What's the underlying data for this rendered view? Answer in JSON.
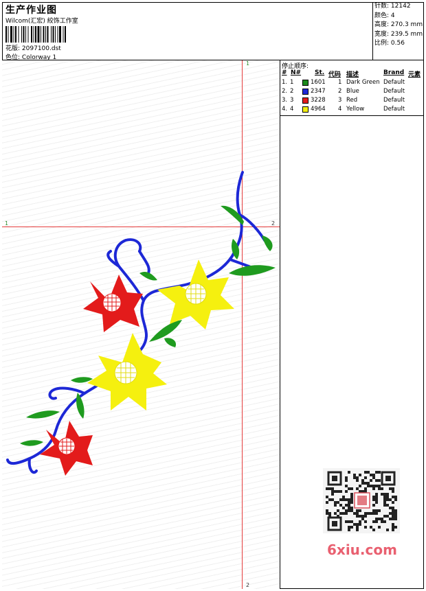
{
  "header": {
    "title": "生产作业图",
    "company": "Wilcom(汇宏) 絞饰工作室",
    "design_label": "花版:",
    "design_value": "2097100.dst",
    "colorway_label": "色位:",
    "colorway_value": "Colorway 1"
  },
  "stats": [
    {
      "label": "针数:",
      "value": "12142"
    },
    {
      "label": "颜色:",
      "value": "4"
    },
    {
      "label": "高度:",
      "value": "270.3 mm"
    },
    {
      "label": "宽度:",
      "value": "239.5 mm"
    },
    {
      "label": "比例:",
      "value": "0.56"
    }
  ],
  "stop_sequence": {
    "title": "停止顺序:",
    "columns": [
      "#",
      "N#",
      "St.",
      "代码",
      "描述",
      "Brand",
      "元素"
    ],
    "rows": [
      {
        "num": "1.",
        "n": "1",
        "color": "#1b8a1b",
        "code": "1601",
        "st": "1",
        "desc": "Dark Green",
        "brand": "Default"
      },
      {
        "num": "2.",
        "n": "2",
        "color": "#1d28d6",
        "code": "2347",
        "st": "2",
        "desc": "Blue",
        "brand": "Default"
      },
      {
        "num": "3.",
        "n": "3",
        "color": "#e31b1b",
        "code": "3228",
        "st": "3",
        "desc": "Red",
        "brand": "Default"
      },
      {
        "num": "4.",
        "n": "4",
        "color": "#f2ee12",
        "code": "4964",
        "st": "4",
        "desc": "Yellow",
        "brand": "Default"
      }
    ]
  },
  "guides": {
    "top_label": "1",
    "bottom_label": "2",
    "left_label": "1",
    "right_label": "2"
  },
  "watermark": {
    "logo_text": "6xiu.com"
  },
  "colors": {
    "green": "#1f9b1f",
    "blue": "#1d28d6",
    "red": "#e31b1b",
    "yellow": "#f5f00f",
    "guide": "#e53b3b"
  }
}
